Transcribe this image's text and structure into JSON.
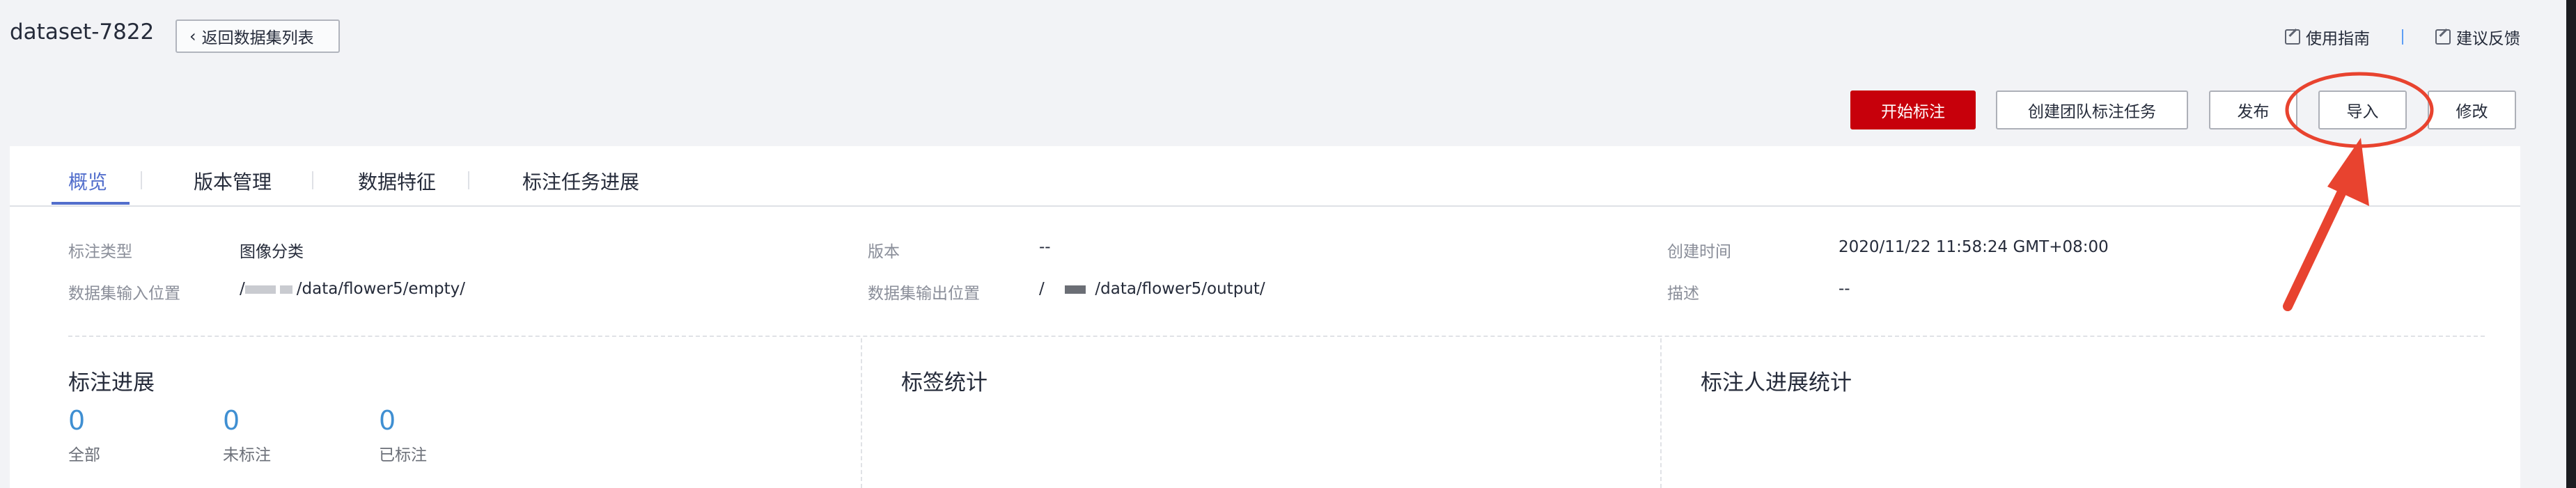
{
  "header": {
    "title": "dataset-7822",
    "back_label": "返回数据集列表",
    "guide_link": "使用指南",
    "feedback_link": "建议反馈"
  },
  "actions": {
    "start_label": "开始标注",
    "team_task_label": "创建团队标注任务",
    "publish_label": "发布",
    "import_label": "导入",
    "modify_label": "修改"
  },
  "tabs": [
    {
      "label": "概览"
    },
    {
      "label": "版本管理"
    },
    {
      "label": "数据特征"
    },
    {
      "label": "标注任务进展"
    }
  ],
  "info": {
    "label_type_label": "标注类型",
    "label_type_value": "图像分类",
    "input_location_label": "数据集输入位置",
    "input_location_value": "/data/flower5/empty/",
    "input_prefix": "/",
    "version_label": "版本",
    "version_value": "--",
    "output_location_label": "数据集输出位置",
    "output_location_prefix": "/",
    "output_location_value": "/data/flower5/output/",
    "created_label": "创建时间",
    "created_value": "2020/11/22 11:58:24 GMT+08:00",
    "desc_label": "描述",
    "desc_value": "--"
  },
  "progress": {
    "title": "标注进展",
    "stats": [
      {
        "value": "0",
        "label": "全部"
      },
      {
        "value": "0",
        "label": "未标注"
      },
      {
        "value": "0",
        "label": "已标注"
      }
    ]
  },
  "label_stats": {
    "title": "标签统计"
  },
  "annotator_stats": {
    "title": "标注人进展统计"
  },
  "colors": {
    "primary": "#c7000b",
    "accent": "#526ecc",
    "number": "#3f8fd2",
    "annotation": "#e8432f"
  },
  "icons": [
    "chevron-left-icon",
    "guide-icon",
    "feedback-icon",
    "annotation-arrow-icon"
  ]
}
